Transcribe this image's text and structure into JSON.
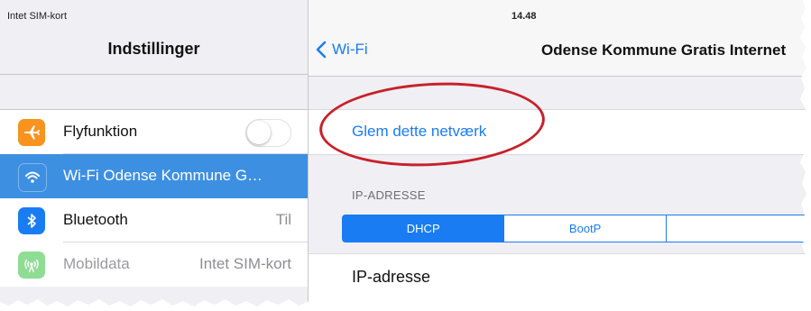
{
  "status_bar": {
    "carrier": "Intet SIM-kort",
    "time": "14.48"
  },
  "left": {
    "title": "Indstillinger",
    "items": [
      {
        "label": "Flyfunktion",
        "value": "",
        "icon": "airplane-icon",
        "color": "#f7931e"
      },
      {
        "label": "Wi-Fi  Odense Kommune G…",
        "value": "",
        "icon": "wifi-icon",
        "color": "#3d8fe2"
      },
      {
        "label": "Bluetooth",
        "value": "Til",
        "icon": "bluetooth-icon",
        "color": "#1a7cf3"
      },
      {
        "label": "Mobildata",
        "value": "Intet SIM-kort",
        "icon": "antenna-icon",
        "color": "#8fdc93"
      }
    ]
  },
  "right": {
    "back_label": "Wi-Fi",
    "title": "Odense Kommune Gratis Internet",
    "forget_label": "Glem dette netværk",
    "section_header": "IP-ADRESSE",
    "segments": [
      "DHCP",
      "BootP"
    ],
    "ip_label": "IP-adresse"
  },
  "colors": {
    "ios_blue": "#1a7cf3",
    "selection": "#3d8fe2",
    "annotation_red": "#c8202a"
  }
}
